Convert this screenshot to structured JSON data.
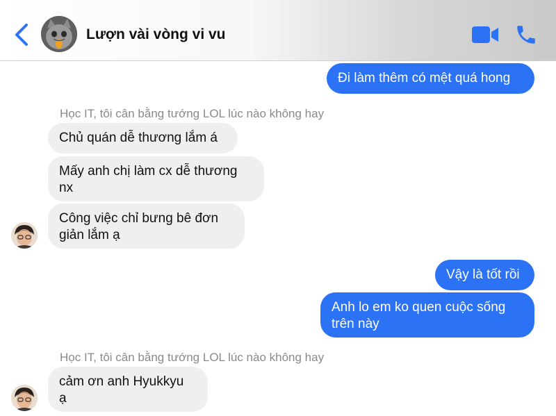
{
  "header": {
    "title": "Lượn vài vòng vi vu"
  },
  "messages": {
    "m1": "Đi làm thêm có mệt quá hong",
    "sender1": "Học IT, tôi cân bằng tướng LOL lúc nào không hay",
    "m2": "Chủ quán dễ thương lắm á",
    "m3": "Mấy anh chị làm cx dễ thương\nnx",
    "m4": "Công việc chỉ bưng bê đơn\ngiản lắm ạ",
    "m5": "Vậy là tốt rồi",
    "m6": "Anh lo em ko quen cuộc sống\ntrên này",
    "sender2": "Học IT, tôi cân bằng tướng LOL lúc nào không hay",
    "m7": "cảm ơn anh Hyukkyu\nạ"
  },
  "colors": {
    "accent": "#2b72f5",
    "incoming_bubble": "#efefef"
  },
  "icons": {
    "back": "chevron-left-icon",
    "video": "video-camera-icon",
    "call": "phone-icon"
  }
}
